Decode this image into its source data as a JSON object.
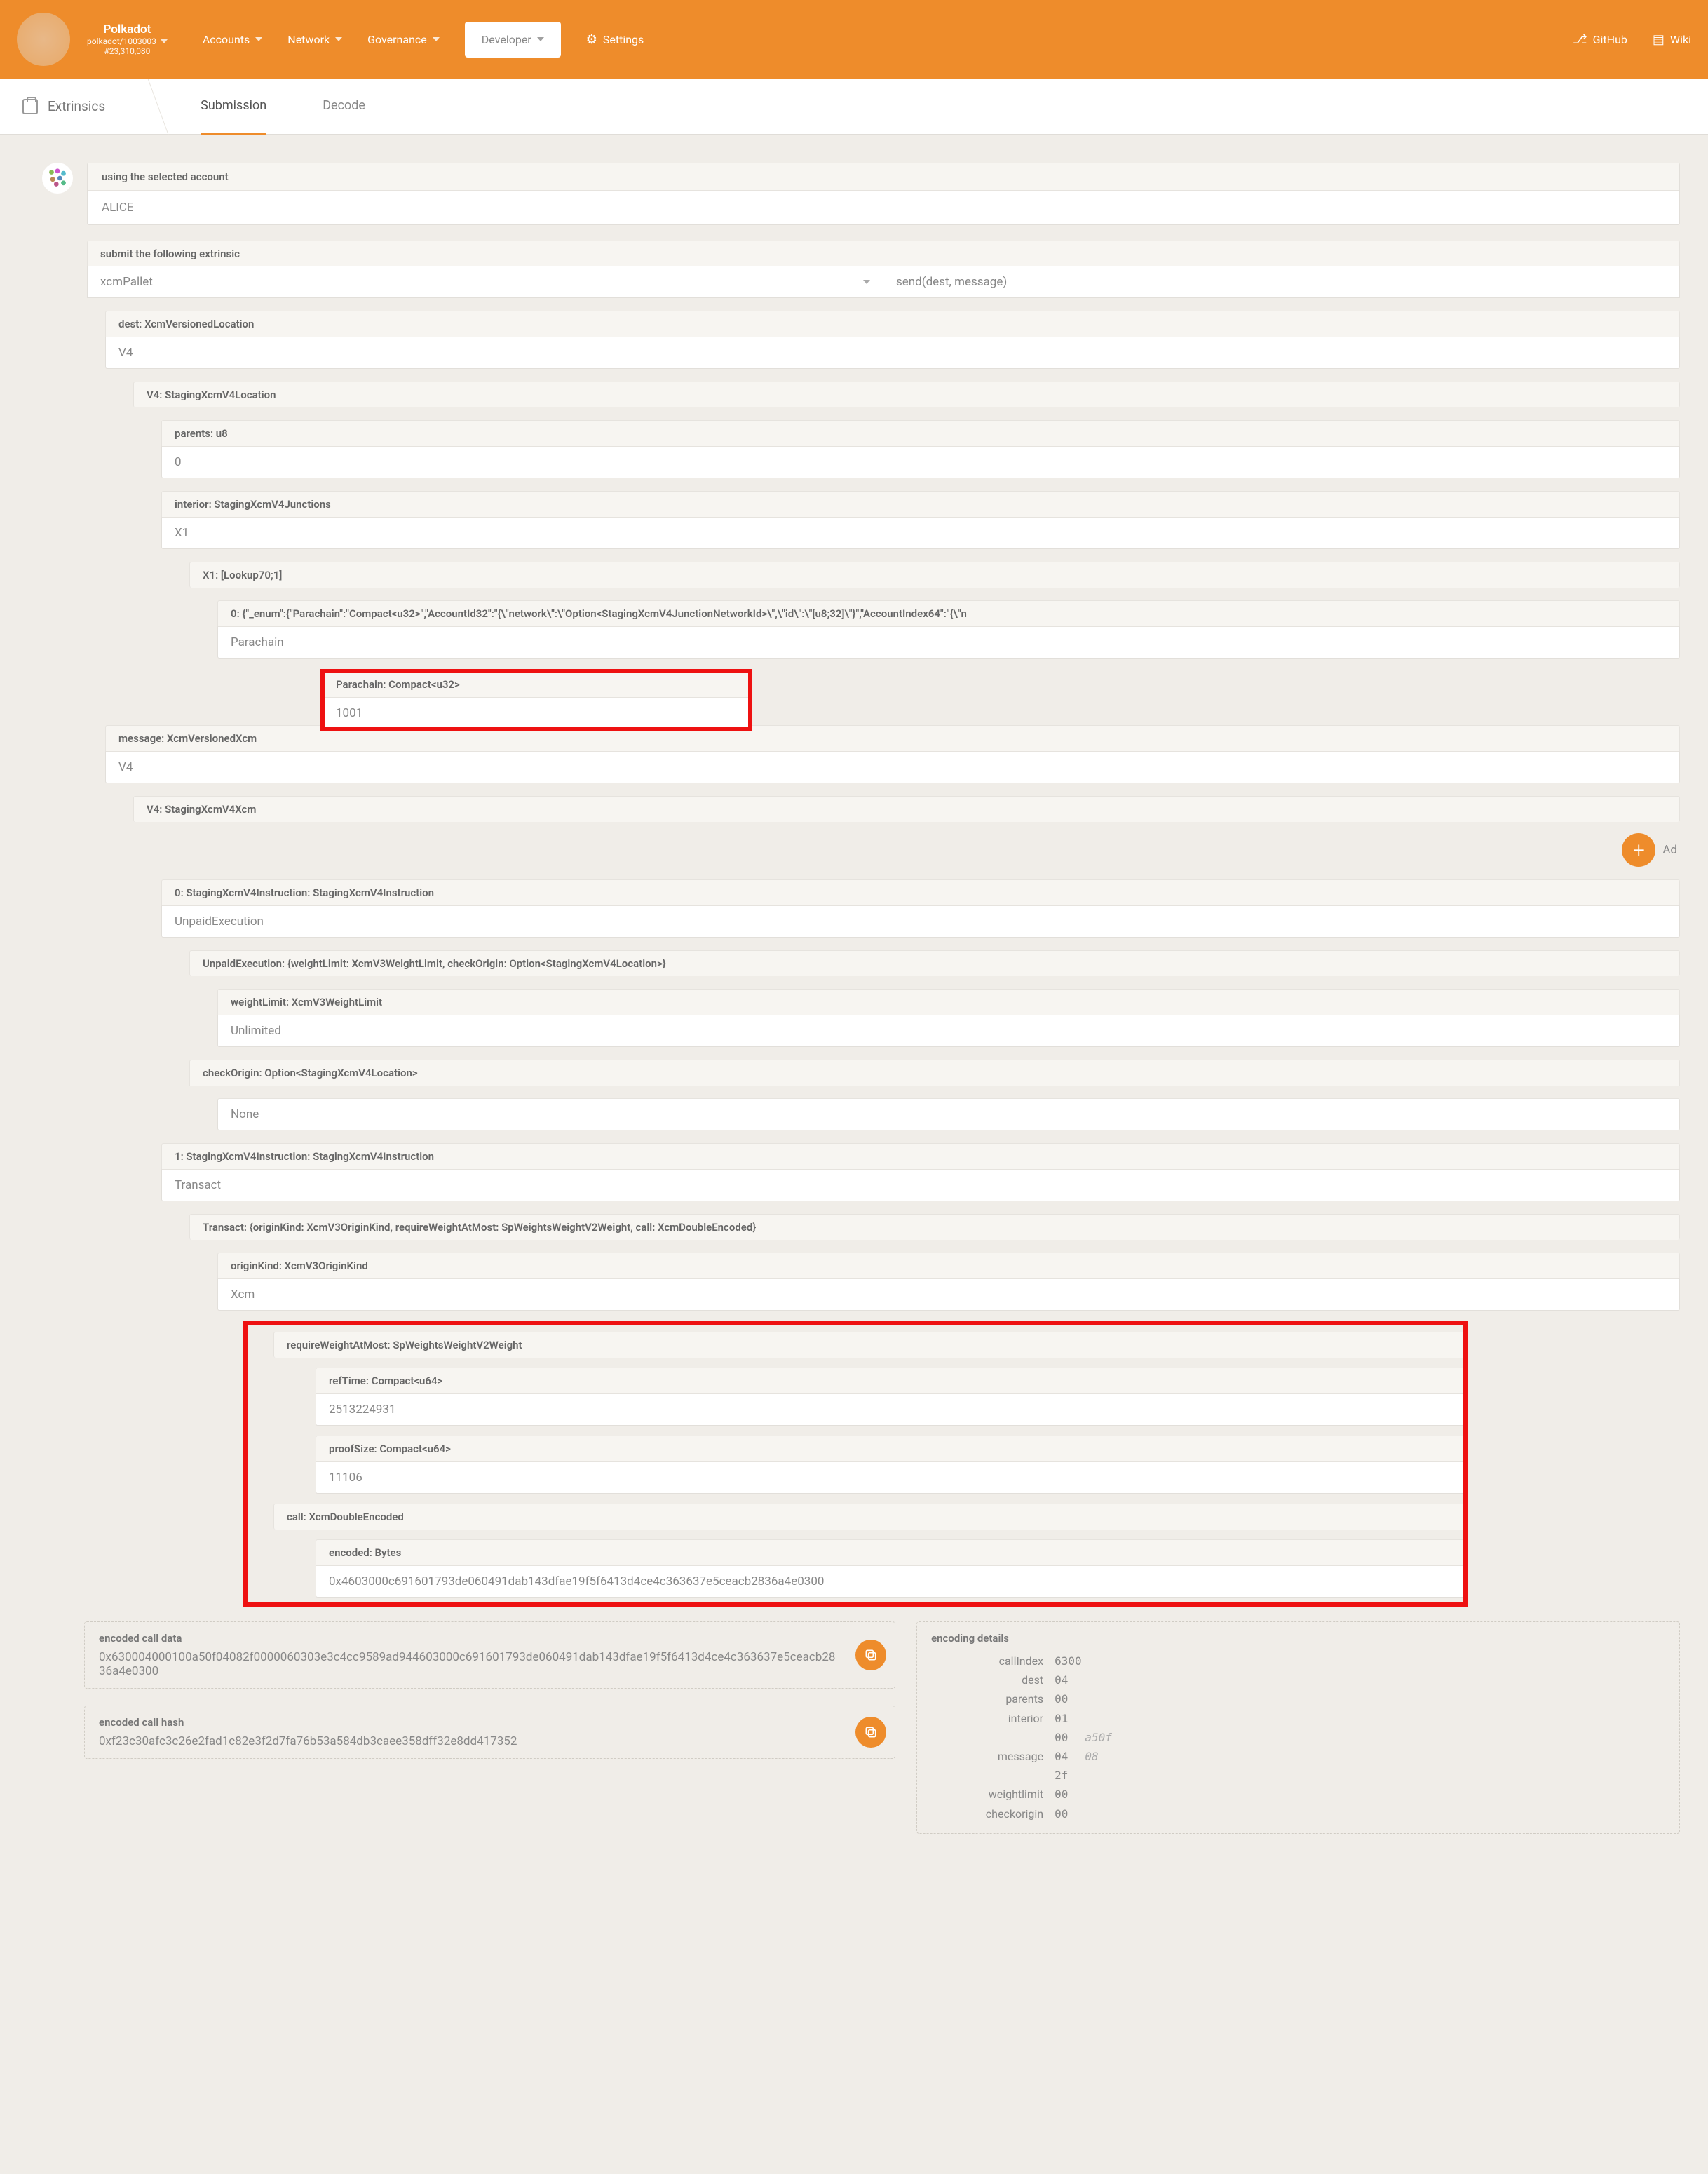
{
  "header": {
    "network_name": "Polkadot",
    "spec": "polkadot/1003003",
    "block": "#23,310,080",
    "nav": {
      "accounts": "Accounts",
      "network": "Network",
      "governance": "Governance",
      "developer": "Developer",
      "settings": "Settings",
      "github": "GitHub",
      "wiki": "Wiki"
    }
  },
  "tabs": {
    "page": "Extrinsics",
    "submission": "Submission",
    "decode": "Decode"
  },
  "account": {
    "label": "using the selected account",
    "name": "ALICE"
  },
  "extrinsic": {
    "label": "submit the following extrinsic",
    "pallet": "xcmPallet",
    "call": "send(dest, message)"
  },
  "dest": {
    "label": "dest: XcmVersionedLocation",
    "value": "V4",
    "v4": {
      "label": "V4: StagingXcmV4Location",
      "parents": {
        "label": "parents: u8",
        "value": "0"
      },
      "interior": {
        "label": "interior: StagingXcmV4Junctions",
        "value": "X1",
        "x1": {
          "label": "X1: [Lookup70;1]",
          "zero": {
            "label": "0: {\"_enum\":{\"Parachain\":\"Compact<u32>\",\"AccountId32\":\"{\\\"network\\\":\\\"Option<StagingXcmV4JunctionNetworkId>\\\",\\\"id\\\":\\\"[u8;32]\\\"}\",\"AccountIndex64\":\"{\\\"n",
            "value": "Parachain",
            "parachain": {
              "label": "Parachain: Compact<u32>",
              "value": "1001"
            }
          }
        }
      }
    }
  },
  "message": {
    "label": "message: XcmVersionedXcm",
    "value": "V4",
    "v4": {
      "label": "V4: StagingXcmV4Xcm",
      "add": "Ad"
    },
    "inst0": {
      "label": "0: StagingXcmV4Instruction: StagingXcmV4Instruction",
      "value": "UnpaidExecution",
      "detail": {
        "label": "UnpaidExecution: {weightLimit: XcmV3WeightLimit, checkOrigin: Option<StagingXcmV4Location>}",
        "weightlimit": {
          "label": "weightLimit: XcmV3WeightLimit",
          "value": "Unlimited"
        },
        "checkorigin": {
          "label": "checkOrigin: Option<StagingXcmV4Location>",
          "value": "None"
        }
      }
    },
    "inst1": {
      "label": "1: StagingXcmV4Instruction: StagingXcmV4Instruction",
      "value": "Transact",
      "detail": {
        "label": "Transact: {originKind: XcmV3OriginKind, requireWeightAtMost: SpWeightsWeightV2Weight, call: XcmDoubleEncoded}",
        "originkind": {
          "label": "originKind: XcmV3OriginKind",
          "value": "Xcm"
        },
        "rwam": {
          "label": "requireWeightAtMost: SpWeightsWeightV2Weight",
          "reftime": {
            "label": "refTime: Compact<u64>",
            "value": "2513224931"
          },
          "proofsize": {
            "label": "proofSize: Compact<u64>",
            "value": "11106"
          }
        },
        "call": {
          "label": "call: XcmDoubleEncoded",
          "encoded": {
            "label": "encoded: Bytes",
            "value": "0x4603000c691601793de060491dab143dfae19f5f6413d4ce4c363637e5ceacb2836a4e0300"
          }
        }
      }
    }
  },
  "summary": {
    "encoded_call_data_label": "encoded call data",
    "encoded_call_data": "0x630004000100a50f04082f0000060303e3c4cc9589ad944603000c691601793de060491dab143dfae19f5f6413d4ce4c363637e5ceacb2836a4e0300",
    "encoded_call_hash_label": "encoded call hash",
    "encoded_call_hash": "0xf23c30afc3c26e2fad1c82e3f2d7fa76b53a584db3caee358dff32e8dd417352",
    "details_label": "encoding details",
    "details": [
      {
        "k": "callIndex",
        "v": "6300",
        "v2": ""
      },
      {
        "k": "dest",
        "v": "04",
        "v2": ""
      },
      {
        "k": "parents",
        "v": "00",
        "v2": ""
      },
      {
        "k": "interior",
        "v": "01",
        "v2": ""
      },
      {
        "k": "",
        "v": "00",
        "v2": "a50f"
      },
      {
        "k": "message",
        "v": "04",
        "v2": "08"
      },
      {
        "k": "",
        "v": "2f",
        "v2": ""
      },
      {
        "k": "weightlimit",
        "v": "00",
        "v2": ""
      },
      {
        "k": "checkorigin",
        "v": "00",
        "v2": ""
      }
    ]
  }
}
